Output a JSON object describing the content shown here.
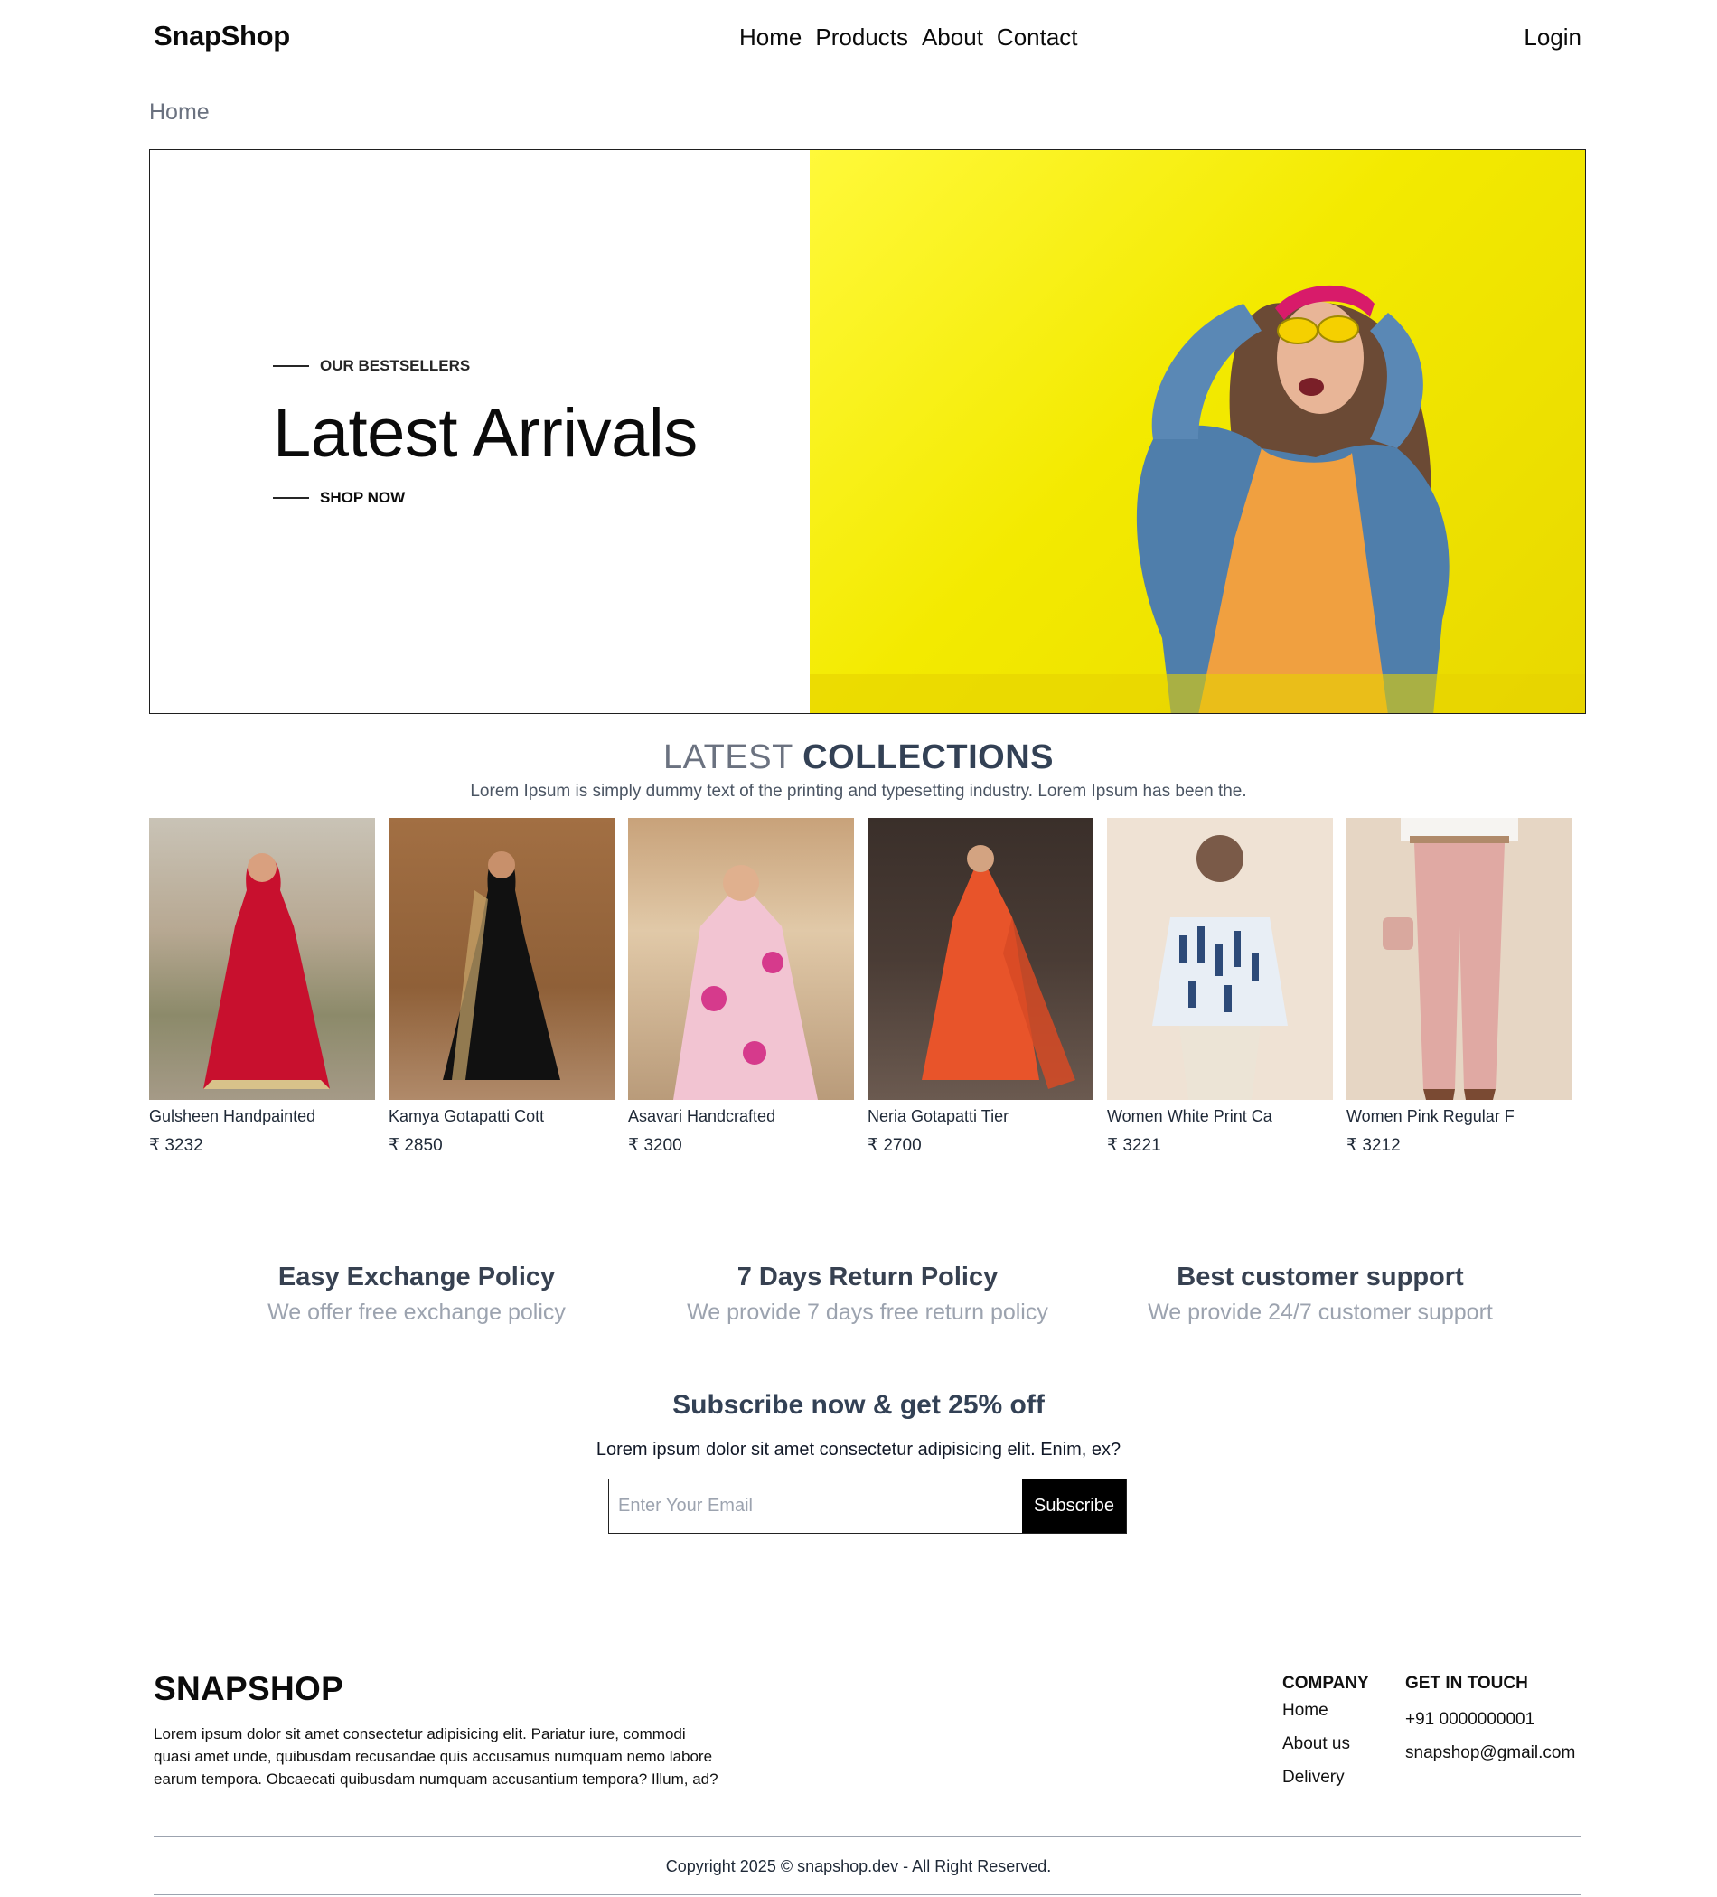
{
  "nav": {
    "logo": "SnapShop",
    "links": [
      "Home",
      "Products",
      "About",
      "Contact"
    ],
    "login": "Login"
  },
  "breadcrumb": "Home",
  "hero": {
    "eyebrow": "OUR BESTSELLERS",
    "title": "Latest Arrivals",
    "cta": "SHOP NOW"
  },
  "collections": {
    "title_light": "LATEST",
    "title_bold": "COLLECTIONS",
    "subtitle": "Lorem Ipsum is simply dummy text of the printing and typesetting industry. Lorem Ipsum has been the."
  },
  "products": [
    {
      "name": "Gulsheen Handpainted",
      "price": "₹ 3232"
    },
    {
      "name": "Kamya Gotapatti Cott",
      "price": "₹ 2850"
    },
    {
      "name": "Asavari Handcrafted",
      "price": "₹ 3200"
    },
    {
      "name": "Neria Gotapatti Tier",
      "price": "₹ 2700"
    },
    {
      "name": "Women White Print Ca",
      "price": "₹ 3221"
    },
    {
      "name": "Women Pink Regular F",
      "price": "₹ 3212"
    }
  ],
  "policies": [
    {
      "title": "Easy Exchange Policy",
      "desc": "We offer free exchange policy"
    },
    {
      "title": "7 Days Return Policy",
      "desc": "We provide 7 days free return policy"
    },
    {
      "title": "Best customer support",
      "desc": "We provide 24/7 customer support"
    }
  ],
  "subscribe": {
    "title": "Subscribe now & get 25% off",
    "desc": "Lorem ipsum dolor sit amet consectetur adipisicing elit. Enim, ex?",
    "placeholder": "Enter Your Email",
    "button": "Subscribe"
  },
  "footer": {
    "brand": "SNAPSHOP",
    "desc": "Lorem ipsum dolor sit amet consectetur adipisicing elit. Pariatur iure, commodi quasi amet unde, quibusdam recusandae quis accusamus numquam nemo labore earum tempora. Obcaecati quibusdam numquam accusantium tempora? Illum, ad?",
    "company_heading": "COMPANY",
    "company_links": [
      "Home",
      "About us",
      "Delivery"
    ],
    "contact_heading": "GET IN TOUCH",
    "phone": "+91 0000000001",
    "email": "snapshop@gmail.com",
    "copyright": "Copyright 2025 © snapshop.dev - All Right Reserved."
  }
}
